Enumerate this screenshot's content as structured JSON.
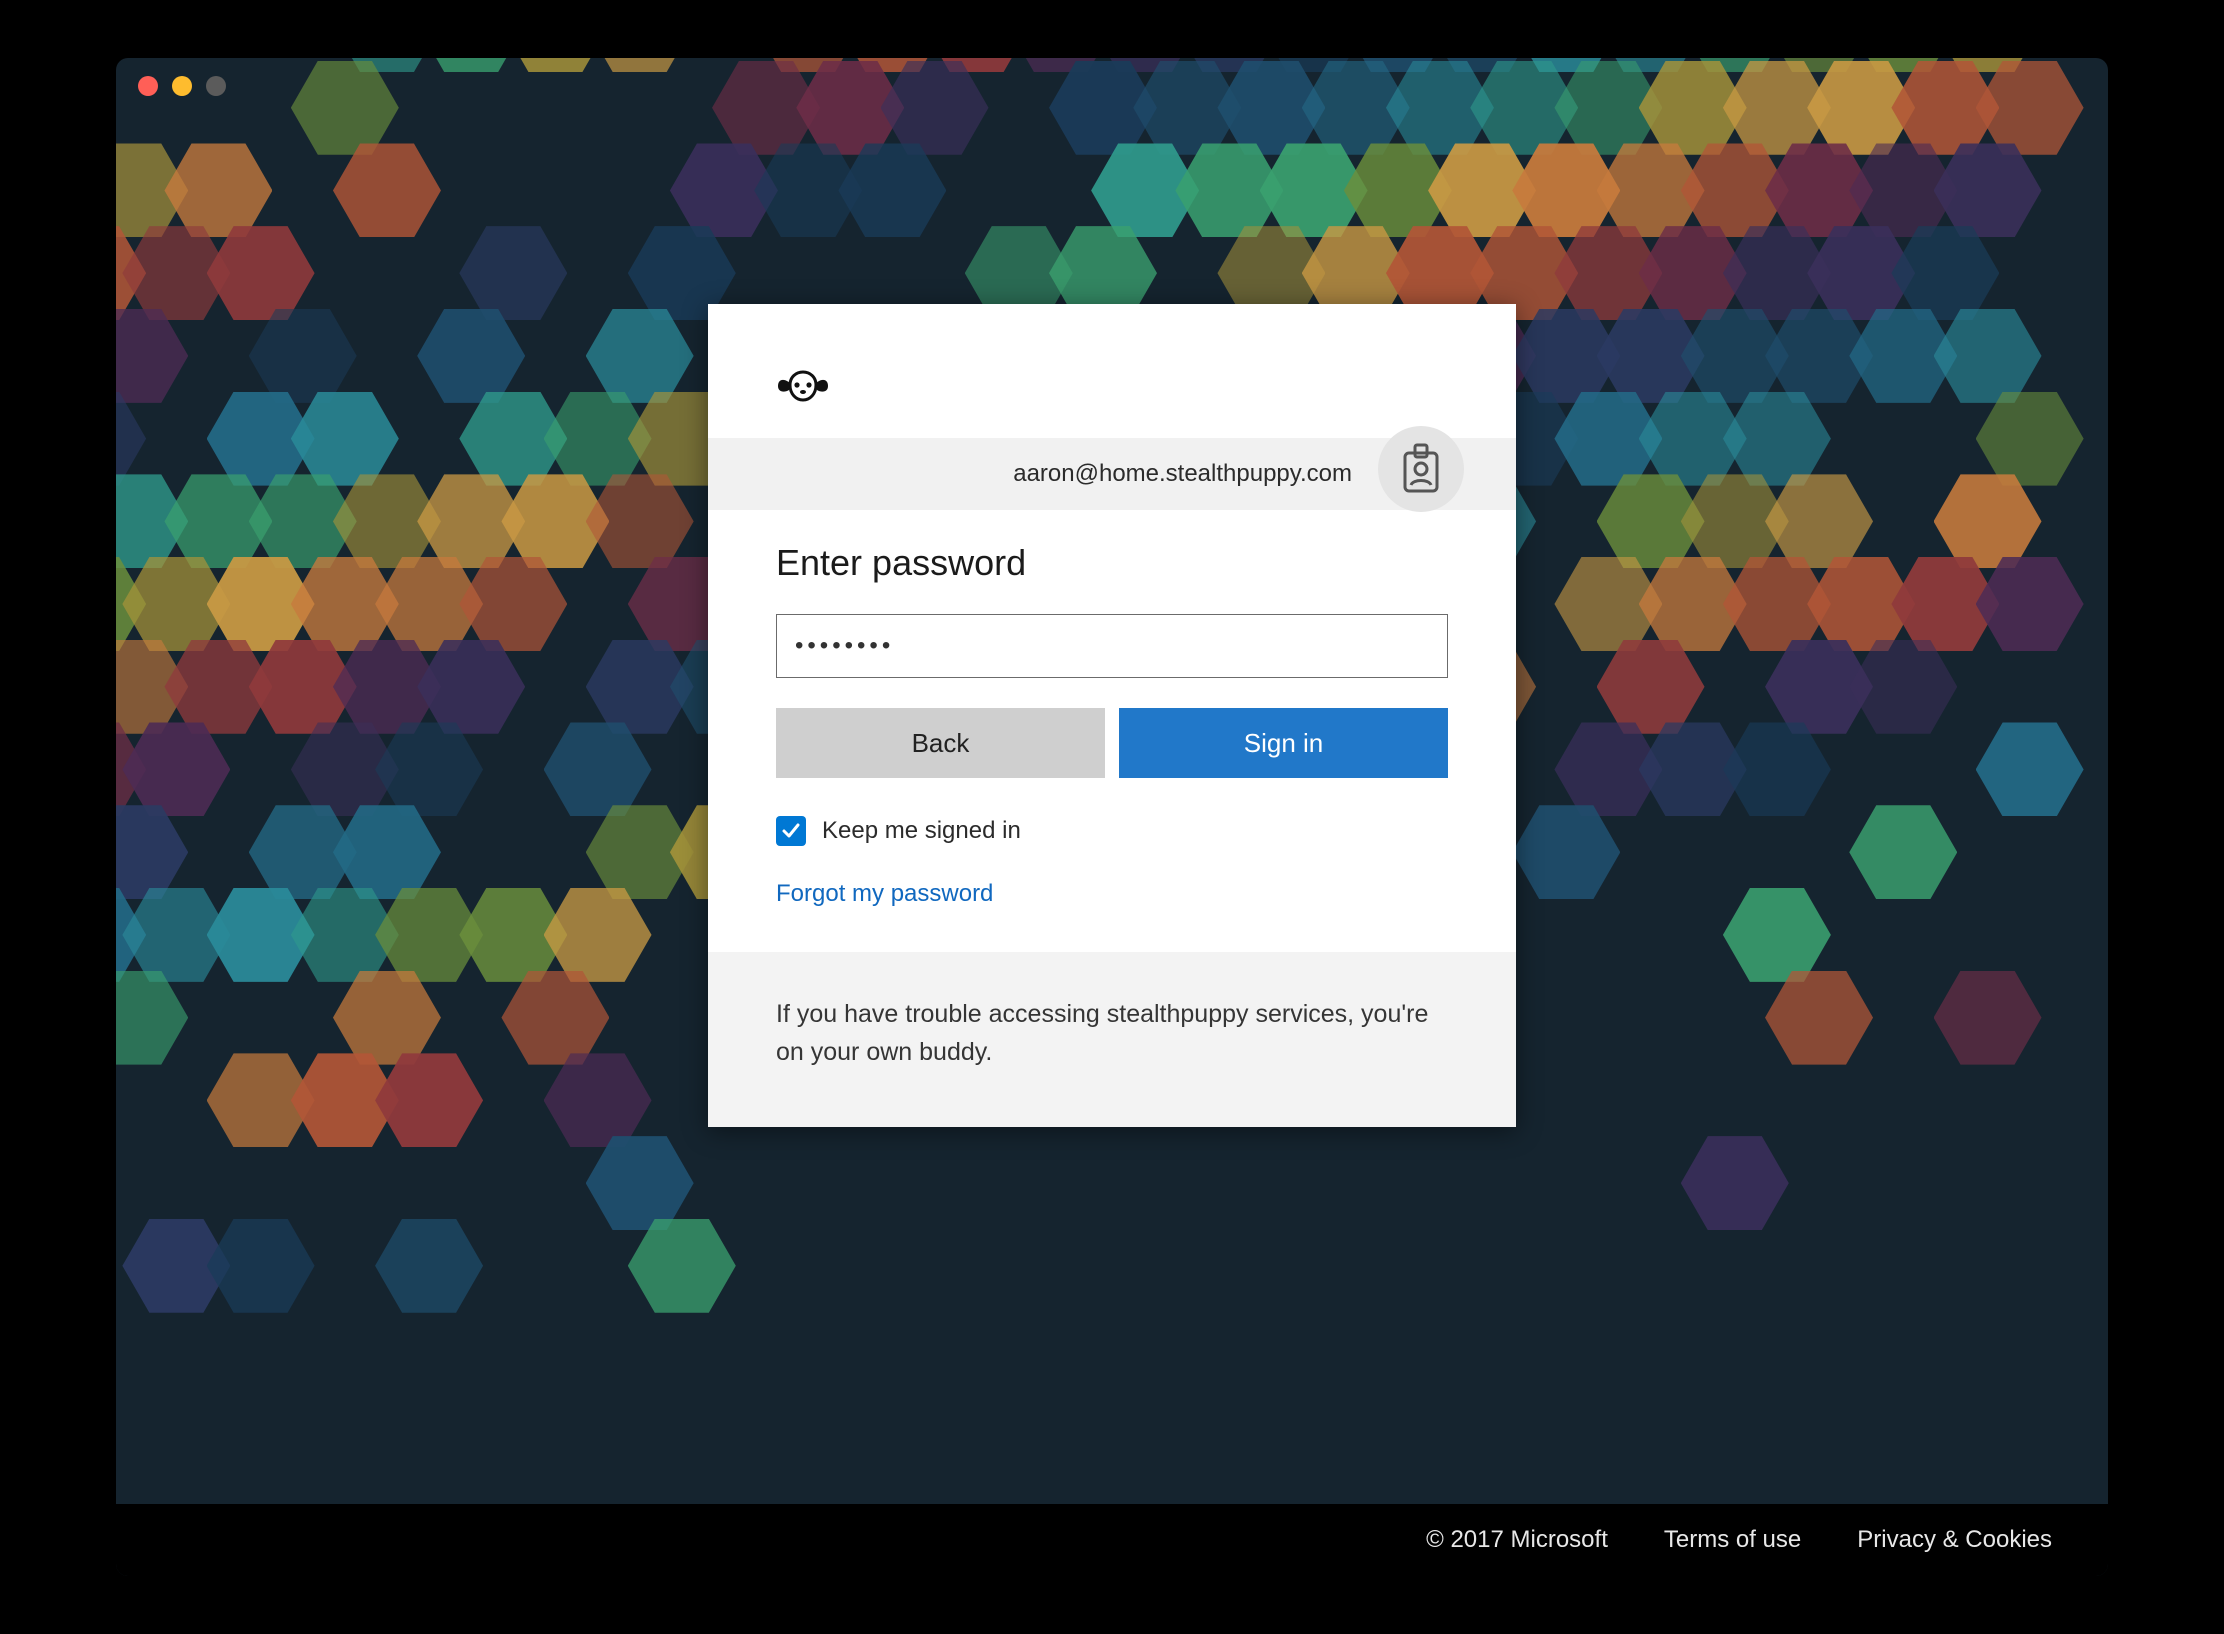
{
  "login": {
    "email": "aaron@home.stealthpuppy.com",
    "title": "Enter password",
    "password_value": "••••••••",
    "back_label": "Back",
    "signin_label": "Sign in",
    "keep_signed_in_label": "Keep me signed in",
    "keep_signed_in_checked": true,
    "forgot_label": "Forgot my password",
    "help_text": "If you have trouble accessing stealthpuppy services, you're on your own buddy."
  },
  "footer": {
    "copyright": "© 2017 Microsoft",
    "terms": "Terms of use",
    "privacy": "Privacy & Cookies"
  },
  "colors": {
    "primary_button": "#2178c9",
    "checkbox": "#0078d4",
    "link": "#1068bf"
  }
}
